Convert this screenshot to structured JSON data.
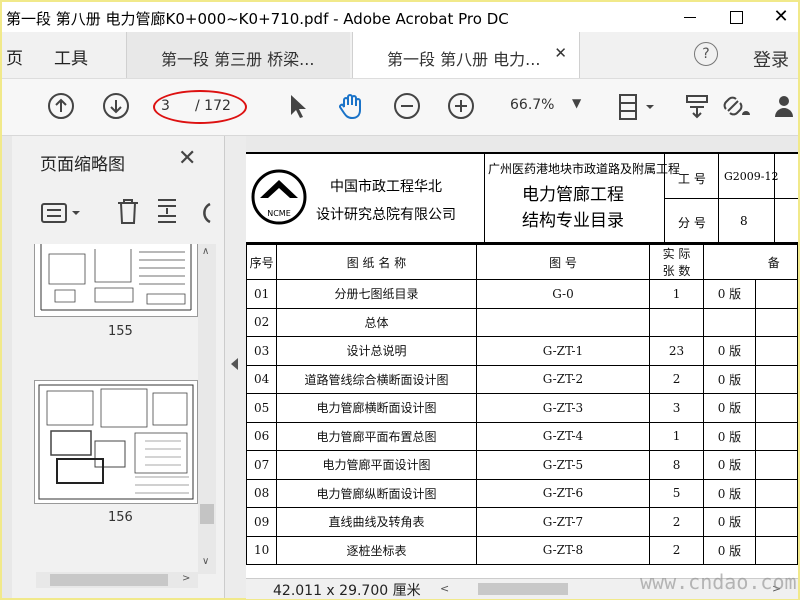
{
  "window": {
    "title": "第一段 第八册 电力管廊K0+000~K0+710.pdf - Adobe Acrobat Pro DC"
  },
  "menubar": {
    "items": [
      "页",
      "工具"
    ],
    "tabs": [
      {
        "label": "第一段 第三册 桥梁..."
      },
      {
        "label": "第一段 第八册 电力..."
      }
    ],
    "login": "登录"
  },
  "toolbar": {
    "page_current": "3",
    "page_total": "/ 172",
    "zoom": "66.7%"
  },
  "sidebar": {
    "title": "页面缩略图",
    "thumbnails": [
      {
        "label": "155"
      },
      {
        "label": "156"
      }
    ]
  },
  "document": {
    "header": {
      "company_line1": "中国市政工程华北",
      "company_line2": "设计研究总院有限公司",
      "logo_text": "NCME",
      "project": "广州医药港地块市政道路及附属工程",
      "title_line1": "电力管廊工程",
      "title_line2": "结构专业目录",
      "job_label": "工 号",
      "job_value": "G2009-12",
      "part_label": "分 号",
      "part_value": "8"
    },
    "columns": {
      "seq": "序号",
      "name": "图 纸 名 称",
      "drawing_no": "图 号",
      "sheets_line1": "实 际",
      "sheets_line2": "张 数",
      "extra": "备"
    },
    "rows": [
      {
        "seq": "01",
        "name": "分册七图纸目录",
        "no": "G-0",
        "count": "1",
        "ver": "0 版"
      },
      {
        "seq": "02",
        "name": "总体",
        "no": "",
        "count": "",
        "ver": ""
      },
      {
        "seq": "03",
        "name": "设计总说明",
        "no": "G-ZT-1",
        "count": "23",
        "ver": "0 版"
      },
      {
        "seq": "04",
        "name": "道路管线综合横断面设计图",
        "no": "G-ZT-2",
        "count": "2",
        "ver": "0 版"
      },
      {
        "seq": "05",
        "name": "电力管廊横断面设计图",
        "no": "G-ZT-3",
        "count": "3",
        "ver": "0 版"
      },
      {
        "seq": "06",
        "name": "电力管廊平面布置总图",
        "no": "G-ZT-4",
        "count": "1",
        "ver": "0 版"
      },
      {
        "seq": "07",
        "name": "电力管廊平面设计图",
        "no": "G-ZT-5",
        "count": "8",
        "ver": "0 版"
      },
      {
        "seq": "08",
        "name": "电力管廊纵断面设计图",
        "no": "G-ZT-6",
        "count": "5",
        "ver": "0 版"
      },
      {
        "seq": "09",
        "name": "直线曲线及转角表",
        "no": "G-ZT-7",
        "count": "2",
        "ver": "0 版"
      },
      {
        "seq": "10",
        "name": "逐桩坐标表",
        "no": "G-ZT-8",
        "count": "2",
        "ver": "0 版"
      }
    ]
  },
  "status": {
    "page_size": "42.011 x 29.700 厘米"
  },
  "watermark": "www.cndao.com"
}
